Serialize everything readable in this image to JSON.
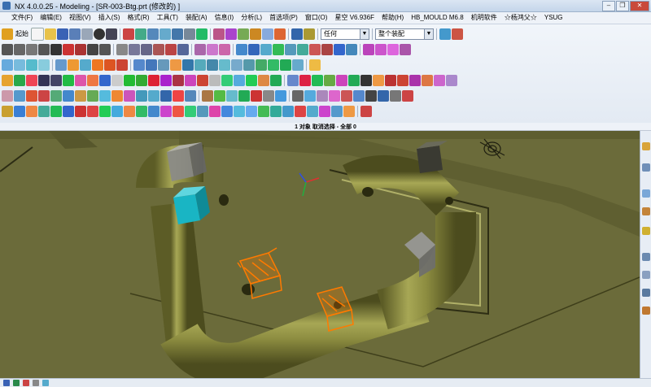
{
  "window": {
    "title": "NX 4.0.0.25 - Modeling - [SR-003-Btg.prt  (修改的) ]"
  },
  "menu": {
    "items": [
      "文件(F)",
      "编辑(E)",
      "视图(V)",
      "插入(S)",
      "格式(R)",
      "工具(T)",
      "装配(A)",
      "信息(I)",
      "分析(L)",
      "首选项(P)",
      "窗口(O)",
      "星空 V6.936F",
      "帮助(H)",
      "HB_MOULD M6.8",
      "机明软件",
      "☆杨鸿父☆",
      "YSUG"
    ]
  },
  "toolbar": {
    "start_label": "起始",
    "filter_value": "任何",
    "assembly_value": "整个装配"
  },
  "status": {
    "selection_text": "1 对象 取消选择 - 全部 0"
  },
  "colors": {
    "pipe": "#8a8a3e",
    "floor": "#6b6b3a",
    "selected_block": "#19b5c4",
    "highlight": "#ff7a00"
  }
}
